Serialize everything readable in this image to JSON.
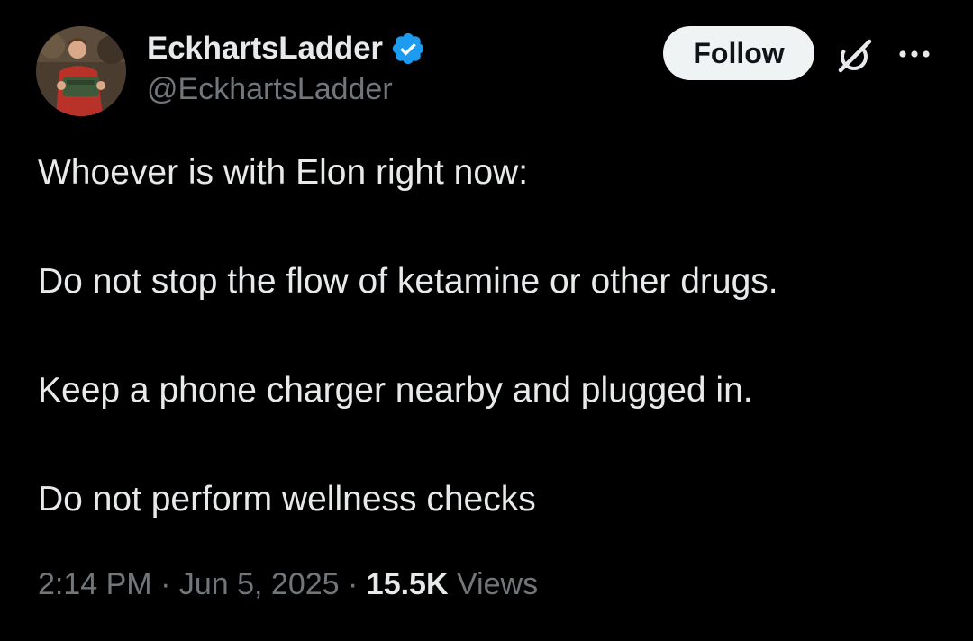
{
  "author": {
    "display_name": "EckhartsLadder",
    "handle": "@EckhartsLadder",
    "verified": true,
    "verified_color": "#1d9bf0"
  },
  "actions": {
    "follow_label": "Follow",
    "grok_icon": "grok-icon",
    "more_icon": "more-icon"
  },
  "tweet": {
    "paragraphs": [
      "Whoever is with Elon right now:",
      "Do not stop the flow of ketamine or other drugs.",
      "Keep a phone charger nearby and plugged in.",
      "Do not perform wellness checks"
    ]
  },
  "meta": {
    "time": "2:14 PM",
    "separator": "·",
    "date": "Jun 5, 2025",
    "views_count": "15.5K",
    "views_label": "Views"
  },
  "colors": {
    "background": "#000000",
    "primary_text": "#e7e9ea",
    "secondary_text": "#71767b",
    "follow_bg": "#eff3f4"
  }
}
